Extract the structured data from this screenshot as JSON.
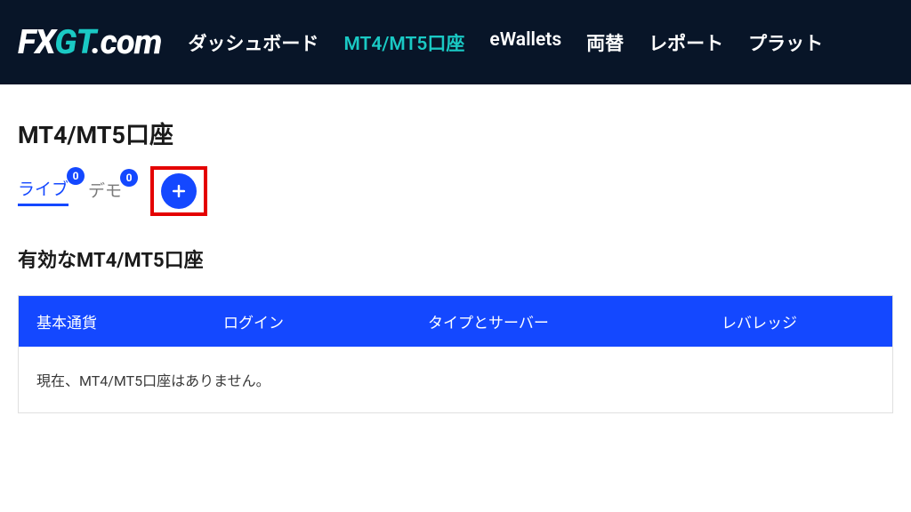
{
  "logo": {
    "prefix": "FX",
    "accent": "GT",
    "suffix": ".com"
  },
  "nav": {
    "items": [
      {
        "label": "ダッシュボード",
        "active": false
      },
      {
        "label": "MT4/MT5口座",
        "active": true
      },
      {
        "label": "eWallets",
        "active": false
      },
      {
        "label": "両替",
        "active": false
      },
      {
        "label": "レポート",
        "active": false
      },
      {
        "label": "プラット",
        "active": false
      }
    ]
  },
  "page": {
    "title": "MT4/MT5口座",
    "section_title": "有効なMT4/MT5口座"
  },
  "tabs": {
    "live": {
      "label": "ライブ",
      "count": "0"
    },
    "demo": {
      "label": "デモ",
      "count": "0"
    }
  },
  "table": {
    "headers": {
      "currency": "基本通貨",
      "login": "ログイン",
      "type_server": "タイプとサーバー",
      "leverage": "レバレッジ"
    },
    "empty_message": "現在、MT4/MT5口座はありません。"
  }
}
